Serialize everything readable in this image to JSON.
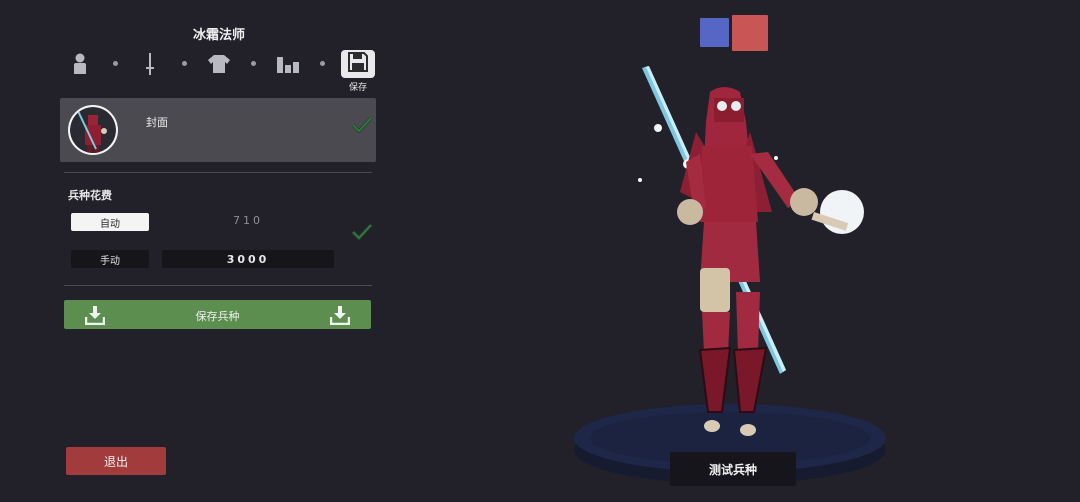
{
  "header": {
    "title": "冰霜法师"
  },
  "steps": [
    {
      "icon": "person-icon"
    },
    {
      "icon": "sword-icon"
    },
    {
      "icon": "shirt-icon"
    },
    {
      "icon": "stats-icon"
    },
    {
      "icon": "save-icon",
      "label": "保存",
      "active": true
    }
  ],
  "cover": {
    "label": "封面",
    "checked": true,
    "avatar_icon": "unit-portrait-icon"
  },
  "cost": {
    "title": "兵种花费",
    "auto_label": "自动",
    "auto_value": "710",
    "manual_label": "手动",
    "manual_value": "3000",
    "checked": true
  },
  "save_unit": {
    "label": "保存兵种",
    "icon": "download-icon"
  },
  "exit": {
    "label": "退出"
  },
  "team_colors": [
    {
      "name": "blue",
      "color": "#5566c4"
    },
    {
      "name": "red",
      "color": "#c95555"
    }
  ],
  "test_unit": {
    "label": "测试兵种"
  },
  "colors": {
    "save_green": "#5b8e4f",
    "exit_red": "#a23c3c",
    "check": "#2c6b3c"
  }
}
